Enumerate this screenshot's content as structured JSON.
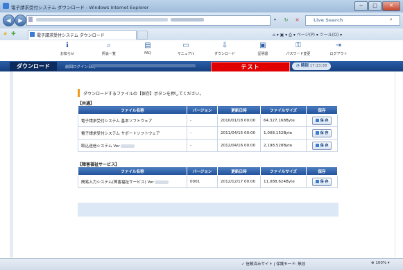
{
  "window": {
    "title": "電子請求受付システム ダウンロード - Windows Internet Explorer",
    "minimize": "−",
    "maximize": "□",
    "close": "✕"
  },
  "browser": {
    "back": "◀",
    "forward": "▶",
    "search_placeholder": "Live Search",
    "tab_title": "電子請求受付システム ダウンロード",
    "tools": "⌂ ▾ ▣ ▾ ⎙ ▾ ページ(P) ▾ ツール(O) ▾"
  },
  "header": {
    "nav": [
      {
        "icon": "ℹ",
        "label": "お知らせ"
      },
      {
        "icon": "⌕",
        "label": "照会一覧"
      },
      {
        "icon": "▤",
        "label": "FAQ"
      },
      {
        "icon": "▭",
        "label": "マニュアル"
      },
      {
        "icon": "⇩",
        "label": "ダウンロード"
      },
      {
        "icon": "▣",
        "label": "証明書"
      },
      {
        "icon": "⚿",
        "label": "パスワード変更"
      },
      {
        "icon": "⇥",
        "label": "ログアウト"
      }
    ]
  },
  "bar": {
    "page_title": "ダウンロード",
    "last_login_label": "前回ログイン日時",
    "env_label": "テスト",
    "time_label": "時刻",
    "time_value": "17:13:38"
  },
  "content": {
    "instruction": "ダウンロードするファイルの【保存】ボタンを押してください。",
    "columns": [
      "ファイル名称",
      "バージョン",
      "更新日時",
      "ファイルサイズ",
      "保存"
    ],
    "save_label": "保 存",
    "sections": [
      {
        "title": "【共通】",
        "rows": [
          {
            "name": "電子請求受付システム 基本ソフトウェア",
            "version": "-",
            "updated": "2010/01/18 00:00",
            "size": "64,327,168Byte"
          },
          {
            "name": "電子請求受付システム サポートソフトウェア",
            "version": "-",
            "updated": "2011/04/15 00:00",
            "size": "1,008,152Byte"
          },
          {
            "name": "取込送信システム Ver",
            "version": "-",
            "updated": "2012/04/16 00:00",
            "size": "2,198,528Byte"
          }
        ]
      },
      {
        "title": "【障害福祉サービス】",
        "rows": [
          {
            "name": "簡易入力システム(障害福祉サービス) Ver",
            "version": "0001",
            "updated": "2012/12/17 00:00",
            "size": "11,088,624Byte"
          }
        ]
      }
    ]
  },
  "statusbar": {
    "zone": "✓ 信頼済みサイト | 保護モード: 無効",
    "zoom": "100%"
  }
}
